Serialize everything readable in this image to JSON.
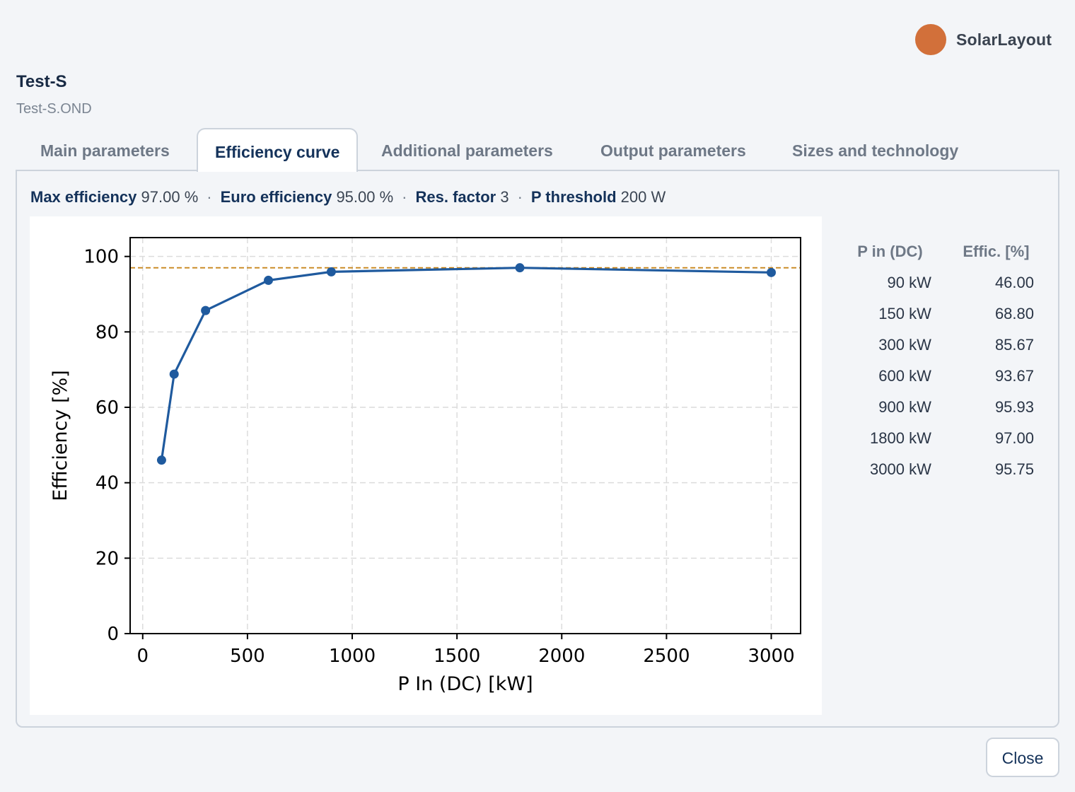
{
  "brand": {
    "name": "SolarLayout",
    "color": "#d2703a"
  },
  "header": {
    "title": "Test-S",
    "filename": "Test-S.OND"
  },
  "tabs": [
    {
      "label": "Main parameters",
      "active": false
    },
    {
      "label": "Efficiency curve",
      "active": true
    },
    {
      "label": "Additional parameters",
      "active": false
    },
    {
      "label": "Output parameters",
      "active": false
    },
    {
      "label": "Sizes and technology",
      "active": false
    }
  ],
  "summary": {
    "max_eff_label": "Max efficiency",
    "max_eff_value": "97.00 %",
    "euro_eff_label": "Euro efficiency",
    "euro_eff_value": "95.00 %",
    "res_factor_label": "Res. factor",
    "res_factor_value": "3",
    "p_threshold_label": "P threshold",
    "p_threshold_value": "200 W",
    "separator": "·"
  },
  "table": {
    "headers": [
      "P in (DC)",
      "Effic. [%]"
    ],
    "rows": [
      [
        "90 kW",
        "46.00"
      ],
      [
        "150 kW",
        "68.80"
      ],
      [
        "300 kW",
        "85.67"
      ],
      [
        "600 kW",
        "93.67"
      ],
      [
        "900 kW",
        "95.93"
      ],
      [
        "1800 kW",
        "97.00"
      ],
      [
        "3000 kW",
        "95.75"
      ]
    ]
  },
  "footer": {
    "close_label": "Close"
  },
  "chart_data": {
    "type": "line",
    "xlabel": "P In (DC) [kW]",
    "ylabel": "Efficiency [%]",
    "xlim": [
      -60,
      3140
    ],
    "ylim": [
      0,
      105
    ],
    "xticks": [
      0,
      500,
      1000,
      1500,
      2000,
      2500,
      3000
    ],
    "yticks": [
      0,
      20,
      40,
      60,
      80,
      100
    ],
    "grid": true,
    "series": [
      {
        "x": [
          90,
          150,
          300,
          600,
          900,
          1800,
          3000
        ],
        "y": [
          46.0,
          68.8,
          85.67,
          93.67,
          95.93,
          97.0,
          95.75
        ],
        "color": "#1f5a9e",
        "marker": "circle"
      }
    ],
    "reference_line": {
      "y": 97.0,
      "style": "dashed",
      "color": "#c8861c"
    }
  }
}
